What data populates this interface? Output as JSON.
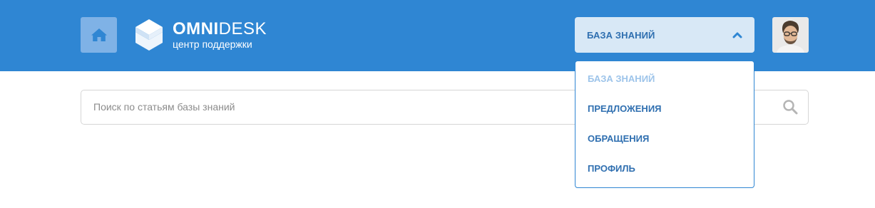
{
  "header": {
    "logo": {
      "name_bold": "OMNI",
      "name_light": "DESK",
      "subtitle": "центр поддержки"
    },
    "kb_toggle_label": "БАЗА ЗНАНИЙ",
    "background_color": "#2f86d3"
  },
  "search": {
    "placeholder": "Поиск по статьям базы знаний",
    "value": ""
  },
  "dropdown": {
    "open": true,
    "items": [
      {
        "label": "БАЗА ЗНАНИЙ",
        "active": true
      },
      {
        "label": "ПРЕДЛОЖЕНИЯ",
        "active": false
      },
      {
        "label": "ОБРАЩЕНИЯ",
        "active": false
      },
      {
        "label": "ПРОФИЛЬ",
        "active": false
      }
    ]
  },
  "icons": {
    "home": "home-icon",
    "toggle": "chevron-up-icon",
    "search": "search-icon",
    "avatar": "user-avatar"
  },
  "colors": {
    "accent": "#2f86d3",
    "link": "#2f6fb0",
    "active_item": "#9dc4ea",
    "toggle_bg": "#d8e8f6"
  }
}
